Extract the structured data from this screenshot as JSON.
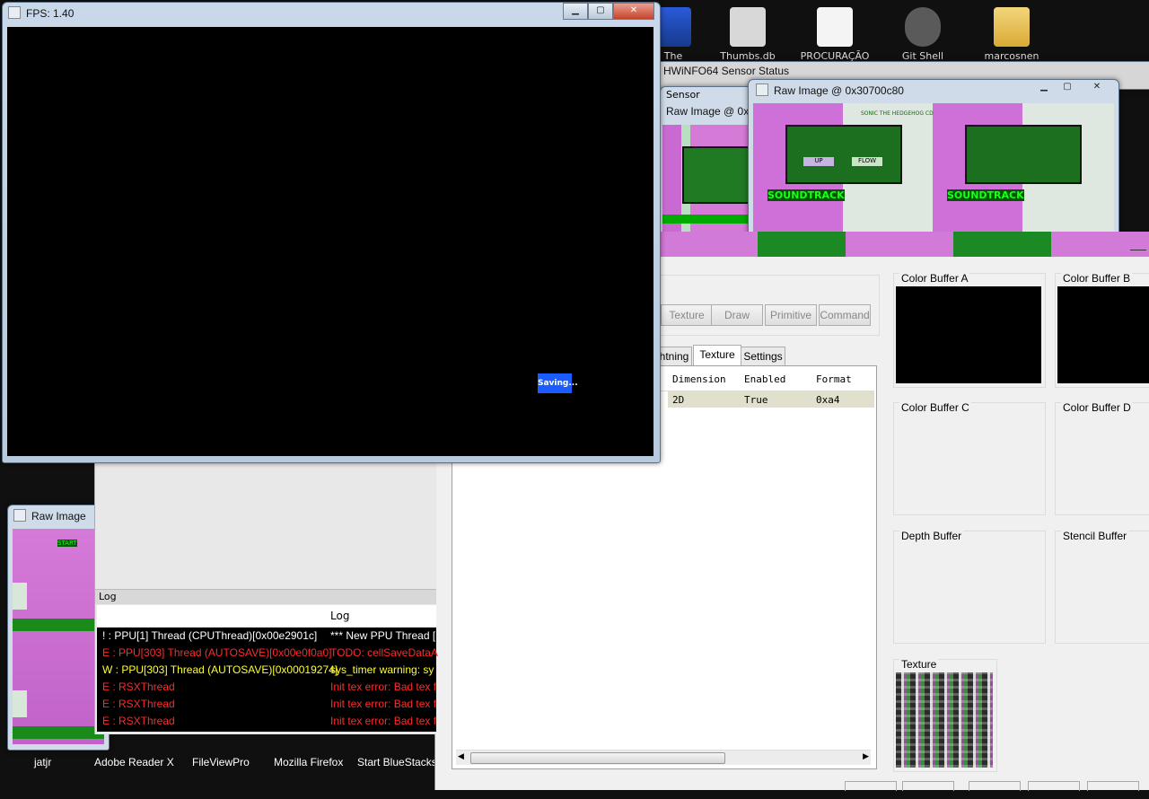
{
  "desktop": {
    "icons": [
      {
        "label": "The",
        "name": "sonic-icon"
      },
      {
        "label": "Thumbs.db",
        "name": "gear-file-icon"
      },
      {
        "label": "PROCURAÇÃO",
        "name": "document-icon"
      },
      {
        "label": "Git Shell",
        "name": "git-shell-icon"
      },
      {
        "label": "marcosnen",
        "name": "folder-icon"
      }
    ]
  },
  "taskbar": {
    "items": [
      "jatjr",
      "Adobe Reader X",
      "FileViewPro",
      "Mozilla Firefox",
      "Start BlueStacks"
    ]
  },
  "game_window": {
    "title": "FPS: 1.40",
    "saving_label": "Saving..."
  },
  "hwinfo_window": {
    "title": "HWiNFO64 Sensor Status",
    "sensor_label": "Sensor"
  },
  "raw_image_back": {
    "title": "Raw Image @ 0x"
  },
  "raw_image_front": {
    "title": "Raw Image @ 0x30700c80",
    "game_texts": [
      "SONIC THE HEDGEHOG CD",
      "SOUNDTRACK",
      "UP",
      "FLOW"
    ]
  },
  "raw_image_left": {
    "title": "Raw Image",
    "label": "START"
  },
  "debugger": {
    "buttons": [
      "Texture",
      "Draw",
      "Primitive",
      "Command"
    ],
    "tabs": [
      "Lightning",
      "Texture",
      "Settings"
    ],
    "active_tab": "Texture",
    "table": {
      "headers": [
        "Dimension",
        "Enabled",
        "Format"
      ],
      "rows": [
        [
          "2D",
          "True",
          "0xa4"
        ]
      ]
    },
    "buffers": [
      "Color Buffer A",
      "Color Buffer B",
      "Color Buffer C",
      "Color Buffer D",
      "Depth Buffer",
      "Stencil Buffer",
      "Texture"
    ]
  },
  "log_window": {
    "title": "Log",
    "column_header": "Log",
    "rows": [
      {
        "source": "! : PPU[1] Thread (CPUThread)[0x00e2901c]",
        "message": "*** New PPU Thread [",
        "color": "#ffffff"
      },
      {
        "source": "E : PPU[303] Thread (AUTOSAVE)[0x00e0f0a0]",
        "message": "TODO: cellSaveDataA",
        "color": "#ff2a2a"
      },
      {
        "source": "W : PPU[303] Thread (AUTOSAVE)[0x00019274]",
        "message": "sys_timer warning: sy",
        "color": "#ffff33"
      },
      {
        "source": "E : RSXThread",
        "message": "Init tex error: Bad tex f",
        "color": "#ff2a2a"
      },
      {
        "source": "E : RSXThread",
        "message": "Init tex error: Bad tex f",
        "color": "#ff2a2a"
      },
      {
        "source": "E : RSXThread",
        "message": "Init tex error: Bad tex f",
        "color": "#ff2a2a"
      }
    ]
  },
  "colors": {
    "accent": "#1a5cff",
    "error": "#ff2a2a",
    "warning": "#ffff33"
  }
}
